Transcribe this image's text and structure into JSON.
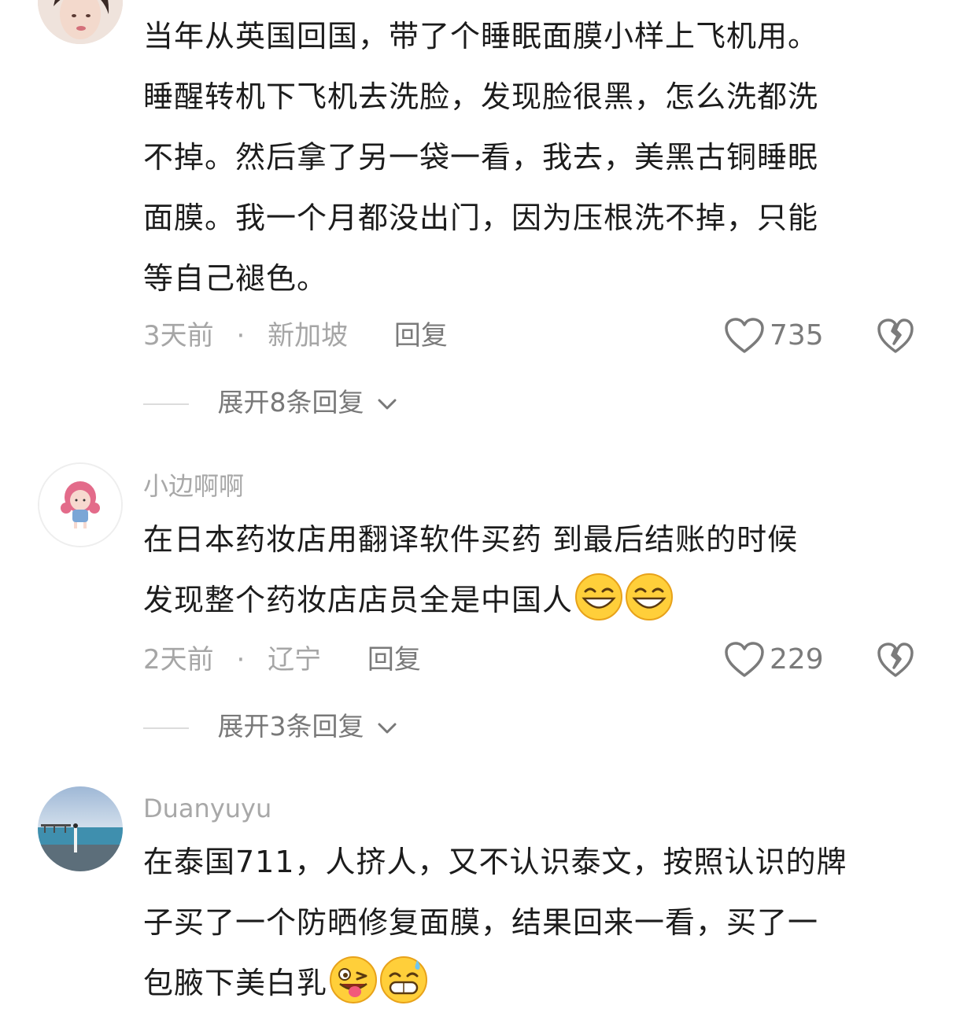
{
  "comments": [
    {
      "username": "",
      "lines": [
        "当年从英国回国，带了个睡眠面膜小样上飞机用。",
        "睡醒转机下飞机去洗脸，发现脸很黑，怎么洗都洗",
        "不掉。然后拿了另一袋一看，我去，美黑古铜睡眠",
        "面膜。我一个月都没出门，因为压根洗不掉，只能",
        "等自己褪色。"
      ],
      "time": "3天前",
      "separator": "·",
      "location": "新加坡",
      "reply_label": "回复",
      "likes": "735",
      "expand_label": "展开8条回复"
    },
    {
      "username": "小边啊啊",
      "lines": [
        "在日本药妆店用翻译软件买药 到最后结账的时候",
        "发现整个药妆店店员全是中国人"
      ],
      "emojis": [
        "grin-emoji",
        "grin-emoji"
      ],
      "time": "2天前",
      "separator": "·",
      "location": "辽宁",
      "reply_label": "回复",
      "likes": "229",
      "expand_label": "展开3条回复"
    },
    {
      "username": "Duanyuyu",
      "lines": [
        "在泰国711，人挤人，又不认识泰文，按照认识的牌",
        "子买了一个防晒修复面膜，结果回来一看，买了一",
        "包腋下美白乳"
      ],
      "emojis": [
        "wink-tongue-emoji",
        "grin-sweat-emoji"
      ]
    }
  ]
}
